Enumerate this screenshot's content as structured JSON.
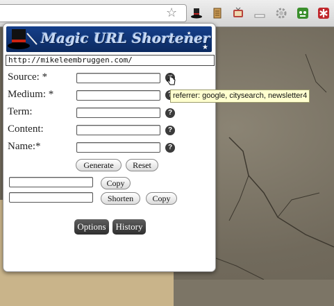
{
  "toolbar": {
    "icons": [
      "bookmark-star-icon",
      "magic-hat-extension-icon",
      "scroll-extension-icon",
      "tv-extension-icon",
      "minimize-extension-icon",
      "gear-extension-icon",
      "green-robot-extension-icon",
      "red-asterisk-extension-icon"
    ]
  },
  "popup": {
    "banner_title": "Magic URL Shortener",
    "url_value": "http://mikeleembruggen.com/",
    "fields": [
      {
        "label": "Source: *",
        "value": ""
      },
      {
        "label": "Medium: *",
        "value": ""
      },
      {
        "label": "Term:",
        "value": ""
      },
      {
        "label": "Content:",
        "value": ""
      },
      {
        "label": "Name:*",
        "value": ""
      }
    ],
    "help_icon_glyph": "?",
    "generate_label": "Generate",
    "reset_label": "Reset",
    "copy_label": "Copy",
    "shorten_label": "Shorten",
    "copy2_label": "Copy",
    "options_label": "Options",
    "history_label": "History"
  },
  "tooltip": {
    "text": "referrer: google, citysearch, newsletter4"
  },
  "colors": {
    "banner": "#153f8a",
    "tooltip_bg": "#ffffcf",
    "dark_button": "#3a3a3a"
  }
}
